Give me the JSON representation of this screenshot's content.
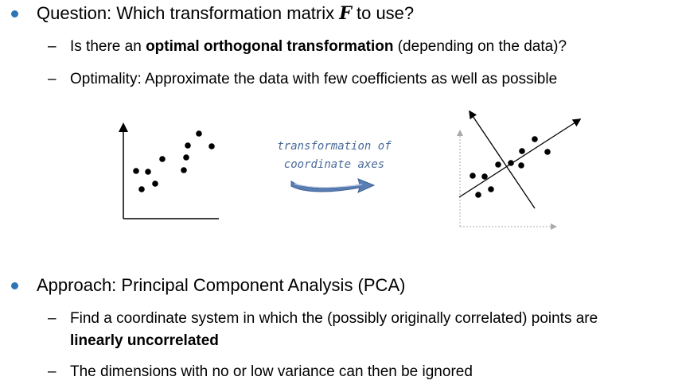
{
  "section1": {
    "bullet_prefix": "Question: Which transformation matrix ",
    "bullet_var": "F",
    "bullet_suffix": " to use?",
    "sub1_prefix": "Is there an ",
    "sub1_bold": "optimal orthogonal transformation",
    "sub1_suffix": " (depending on the data)?",
    "sub2": "Optimality: Approximate the data with few coefficients as well as possible"
  },
  "figure": {
    "annotation_line1": "transformation of",
    "annotation_line2": "coordinate axes",
    "arrow_color": "#5a7fb5"
  },
  "section2": {
    "bullet": "Approach: Principal Component Analysis (PCA)",
    "sub1_text": "Find a coordinate system in which the (possibly originally correlated) points are",
    "sub1_bold": "linearly uncorrelated",
    "sub2": "The dimensions with no or low variance can then be ignored"
  },
  "dash_glyph": "–",
  "bullet_color": "#2e75b6"
}
